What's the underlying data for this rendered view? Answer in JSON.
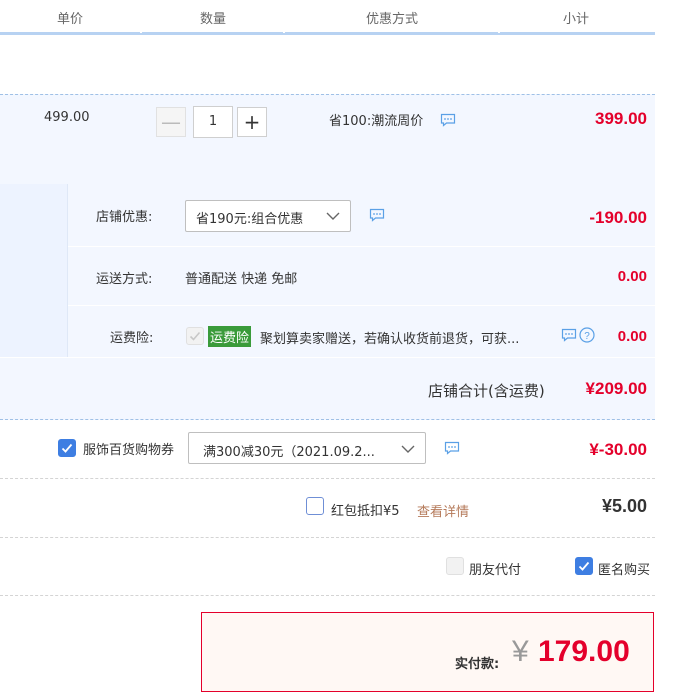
{
  "header": {
    "col_unit_price": "单价",
    "col_quantity": "数量",
    "col_discount": "优惠方式",
    "col_subtotal": "小计"
  },
  "item": {
    "unit_price": "499.00",
    "quantity": "1",
    "discount_text": "省100:潮流周价",
    "subtotal": "399.00",
    "minus_symbol": "—",
    "plus_symbol": "+"
  },
  "shop": {
    "promo_label": "店铺优惠:",
    "promo_select": "省190元:组合优惠",
    "promo_amount": "-190.00",
    "shipping_label": "运送方式:",
    "shipping_text": "普通配送 快递 免邮",
    "shipping_amount": "0.00",
    "insurance_label": "运费险:",
    "insurance_badge": "运费险",
    "insurance_text": "聚划算卖家赠送，若确认收货前退货，可获...",
    "insurance_amount": "0.00",
    "total_label": "店铺合计(含运费)",
    "total_amount": "¥209.00"
  },
  "coupon": {
    "label": "服饰百货购物券",
    "select": "满300减30元（2021.09.2...",
    "amount": "¥-30.00",
    "checked": true
  },
  "redpacket": {
    "label": "红包抵扣¥5",
    "link": "查看详情",
    "amount": "¥5.00",
    "checked": false
  },
  "options": {
    "friend_pay": "朋友代付",
    "anonymous": "匿名购买",
    "anonymous_checked": true
  },
  "payment": {
    "label": "实付款:",
    "currency": "¥",
    "amount": "179.00"
  },
  "colors": {
    "accent_red": "#e4002b",
    "accent_blue": "#3e7ee2",
    "badge_green": "#3a9b3a"
  }
}
